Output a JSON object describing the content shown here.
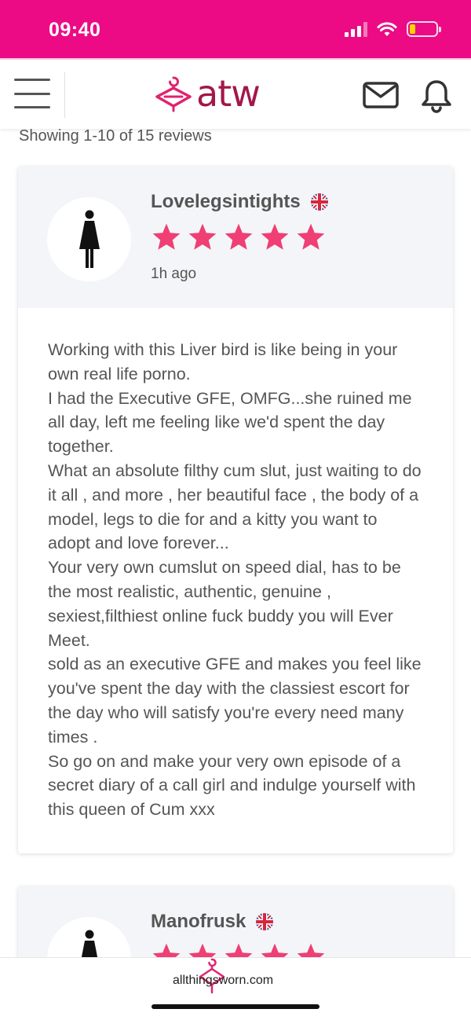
{
  "status_bar": {
    "time": "09:40",
    "icons": [
      "cellular-signal-icon",
      "wifi-icon",
      "low-battery-icon"
    ],
    "battery_color": "#ffd400"
  },
  "header": {
    "logo_text": "atw",
    "icons": [
      "hamburger-menu-icon",
      "hanger-logo-icon",
      "mail-icon",
      "bell-icon"
    ],
    "brand_color": "#a3174a",
    "accent_color": "#ec0b84"
  },
  "reviews": {
    "summary": "Showing 1-10 of 15 reviews",
    "items": [
      {
        "reviewer": "Lovelegsintights",
        "flag": "uk-flag-icon",
        "rating": 5,
        "time_ago": "1h ago",
        "text": "Working with this Liver bird is like being in your own real life porno.\nI had the Executive GFE, OMFG...she ruined me all day, left me feeling like we'd spent the day together.\nWhat an absolute filthy cum slut, just waiting to do it all , and more , her beautiful face , the body of a model, legs to die for and a kitty you want to adopt and love forever...\nYour very own cumslut on speed dial, has to be the most realistic, authentic, genuine , sexiest,filthiest online fuck buddy you will Ever Meet.\nsold as an executive GFE and makes you feel like you've spent the day with the classiest escort for the day who will satisfy you're every need many times .\nSo go on and make your very own episode of a secret diary of a call girl and indulge yourself with this queen of Cum xxx"
      },
      {
        "reviewer": "Manofrusk",
        "flag": "uk-flag-icon",
        "rating": 5
      }
    ],
    "star_color": "#ef3f74"
  },
  "footer": {
    "brand": "allthingsworn.com"
  }
}
